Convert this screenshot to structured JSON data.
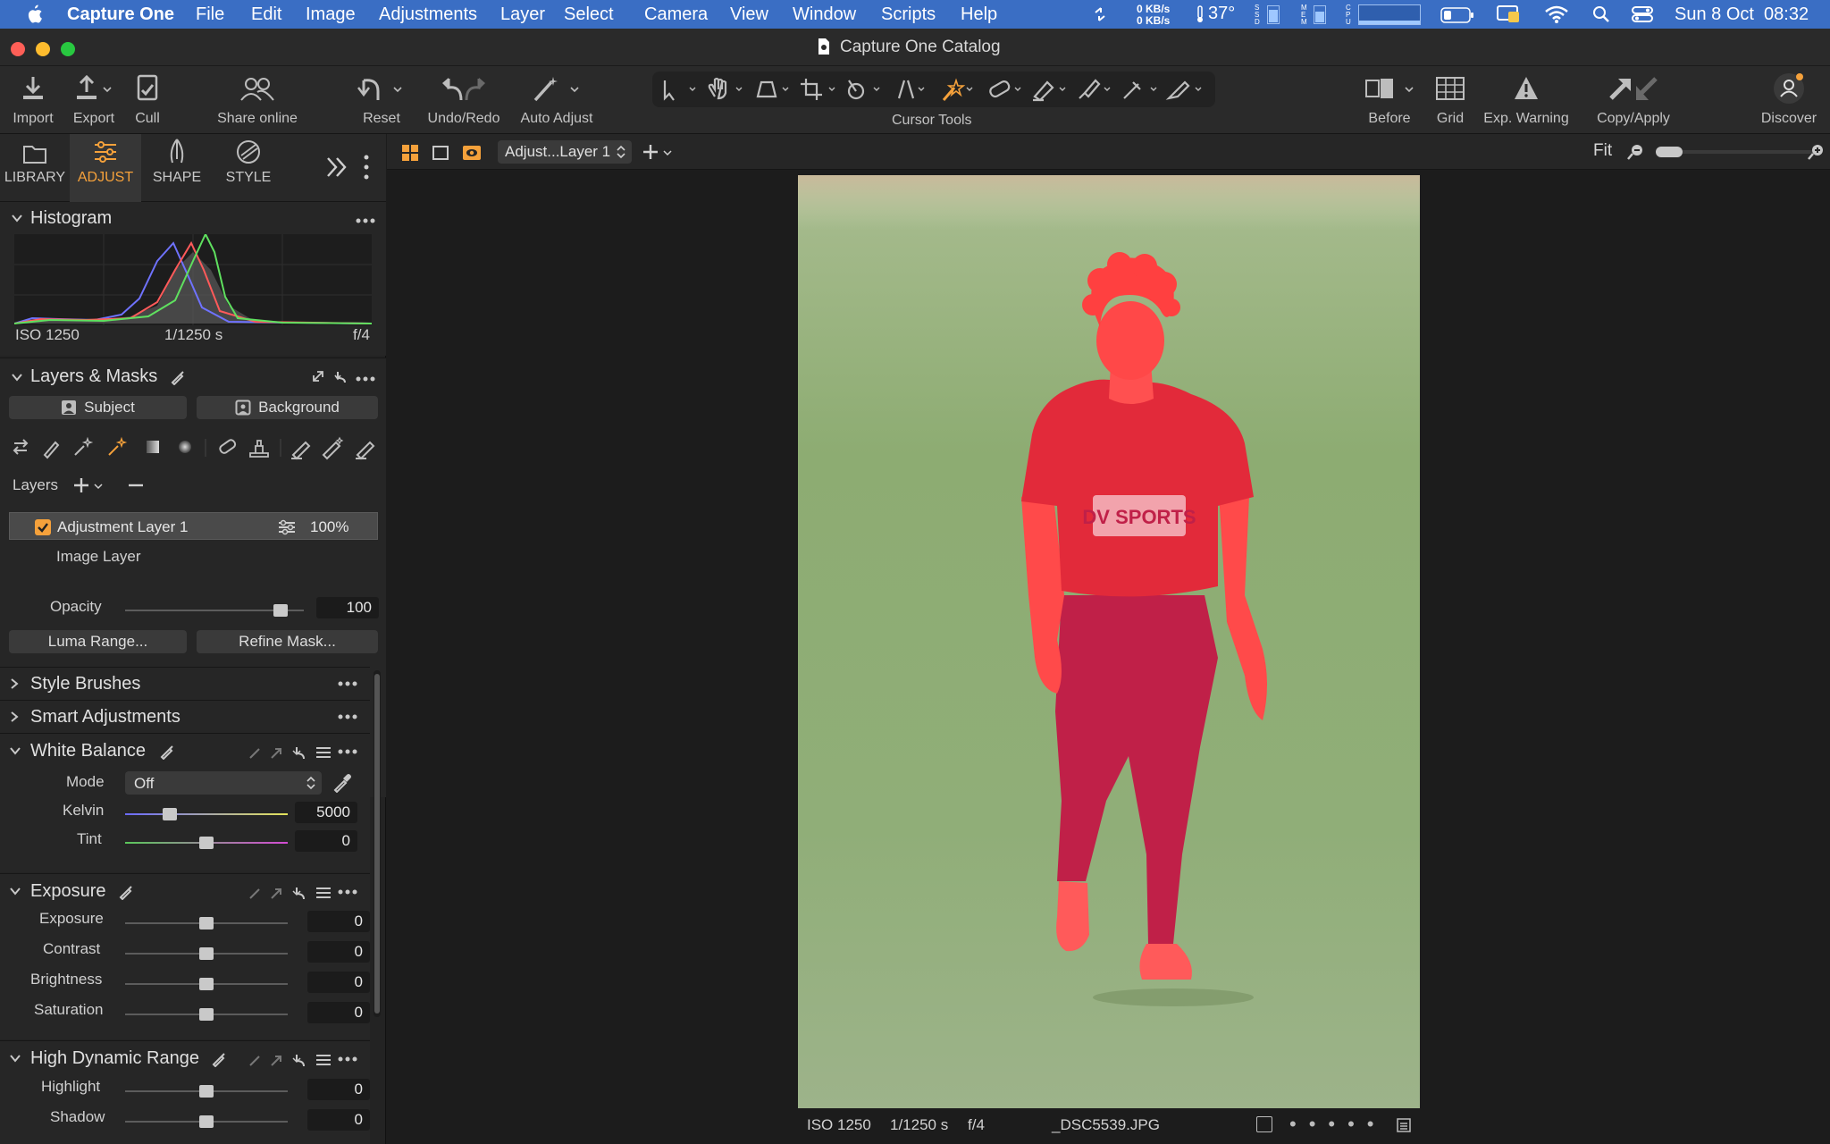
{
  "menubar": {
    "app": "Capture One",
    "items": [
      "File",
      "Edit",
      "Image",
      "Adjustments",
      "Layer",
      "Select",
      "Camera",
      "View",
      "Window",
      "Scripts",
      "Help"
    ],
    "net_up": "0 KB/s",
    "net_down": "0 KB/s",
    "temp": "37°",
    "datetime": "Sun 8 Oct  08:32",
    "ssd": "SSD",
    "mem": "MEM",
    "cpu": "CPU"
  },
  "window": {
    "title": "Capture One Catalog"
  },
  "toolbar": {
    "import": "Import",
    "export": "Export",
    "cull": "Cull",
    "share": "Share online",
    "reset": "Reset",
    "undoredo": "Undo/Redo",
    "auto": "Auto Adjust",
    "cursor": "Cursor Tools",
    "before": "Before",
    "grid": "Grid",
    "expwarn": "Exp. Warning",
    "copyapply": "Copy/Apply",
    "discover": "Discover"
  },
  "tabs": {
    "library": "LIBRARY",
    "adjust": "ADJUST",
    "shape": "SHAPE",
    "style": "STYLE"
  },
  "histogram": {
    "title": "Histogram",
    "iso": "ISO 1250",
    "shutter": "1/1250 s",
    "aperture": "f/4"
  },
  "layers": {
    "title": "Layers & Masks",
    "subject": "Subject",
    "background": "Background",
    "layers_label": "Layers",
    "layer1": "Adjustment Layer 1",
    "layer1_opacity": "100%",
    "image_layer": "Image Layer",
    "opacity_label": "Opacity",
    "opacity_value": "100",
    "opacity_level": 1.0,
    "luma": "Luma Range...",
    "refine": "Refine Mask..."
  },
  "sections": {
    "style_brushes": "Style Brushes",
    "smart": "Smart Adjustments",
    "wb": "White Balance",
    "exposure": "Exposure",
    "hdr": "High Dynamic Range"
  },
  "wb": {
    "mode_label": "Mode",
    "mode_value": "Off",
    "kelvin_label": "Kelvin",
    "kelvin_value": "5000",
    "tint_label": "Tint",
    "tint_value": "0"
  },
  "exposure": {
    "exposure_label": "Exposure",
    "exposure_value": "0",
    "contrast_label": "Contrast",
    "contrast_value": "0",
    "brightness_label": "Brightness",
    "brightness_value": "0",
    "saturation_label": "Saturation",
    "saturation_value": "0"
  },
  "hdr": {
    "highlight_label": "Highlight",
    "highlight_value": "0",
    "shadow_label": "Shadow",
    "shadow_value": "0"
  },
  "viewer": {
    "layer_select": "Adjust...Layer 1",
    "fit": "Fit",
    "shirt_text": "DV SPORTS"
  },
  "status": {
    "iso": "ISO 1250",
    "shutter": "1/1250 s",
    "aperture": "f/4",
    "filename": "_DSC5539.JPG"
  },
  "colors": {
    "accent": "#f5a13b",
    "menubar": "#3a6ec4",
    "mask": "#ff3c3c"
  }
}
